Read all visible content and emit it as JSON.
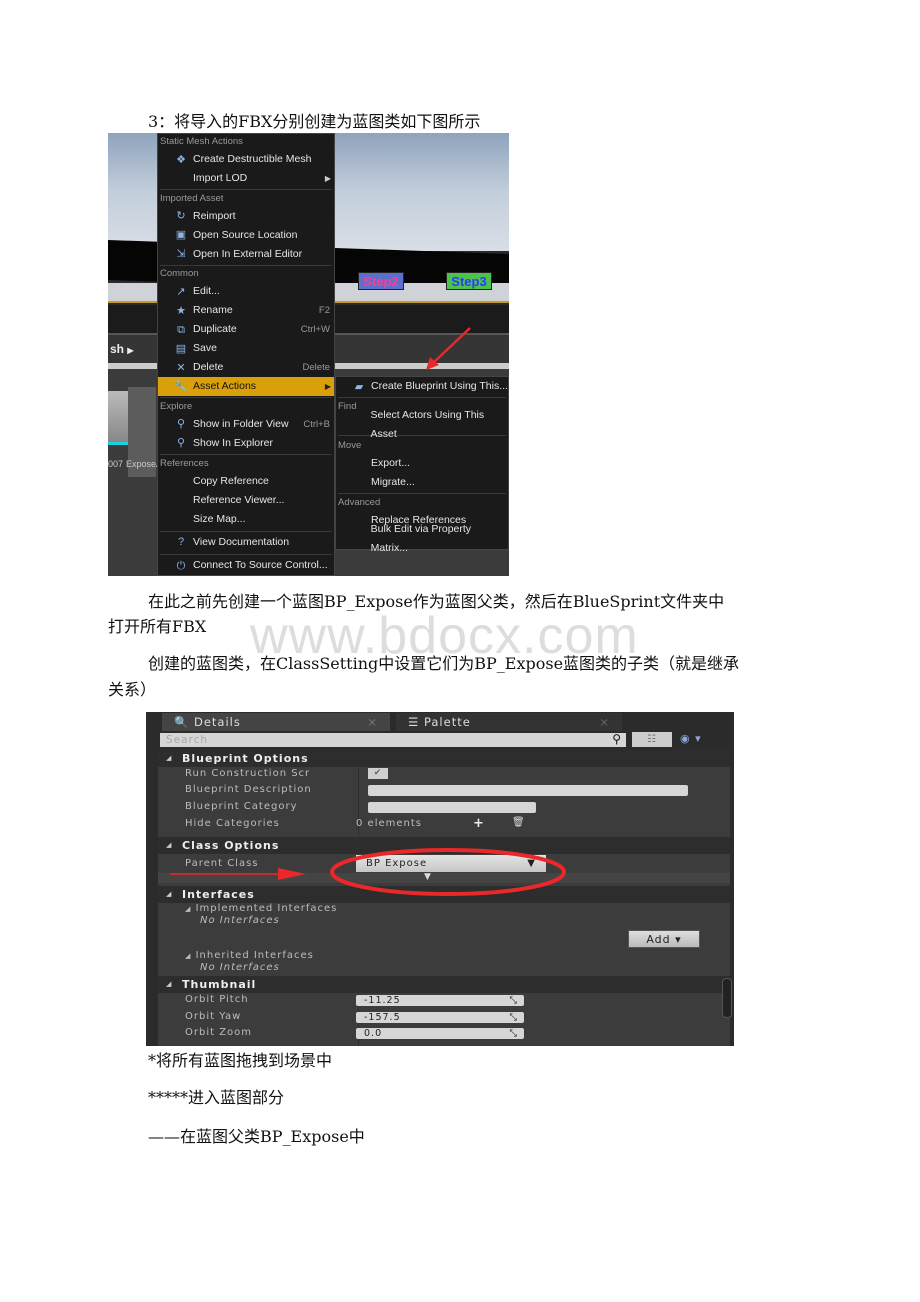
{
  "doc": {
    "heading": "3：将导入的FBX分别创建为蓝图类如下图所示",
    "para1_line1": "在此之前先创建一个蓝图BP_Expose作为蓝图父类，然后在BlueSprint文件夹中",
    "para1_line2": "打开所有FBX",
    "para2_line1": "创建的蓝图类，在ClassSetting中设置它们为BP_Expose蓝图类的子类（就是继承",
    "para2_line2": "关系）",
    "line3": "*将所有蓝图拖拽到场景中",
    "line4": "*****进入蓝图部分",
    "line5": "——在蓝图父类BP_Expose中",
    "watermark": "www.bdocx.com"
  },
  "shot1": {
    "breadcrumb": "sh",
    "steps": [
      {
        "label": "Step2",
        "bg": "#5a6fcf",
        "fg": "#ff3d8a"
      },
      {
        "label": "Step3",
        "bg": "#4cc24c",
        "fg": "#2b3cff"
      }
    ],
    "thumb_labels": [
      "007",
      "ExposeA"
    ],
    "menu": {
      "sections": [
        {
          "header": "Static Mesh Actions",
          "items": [
            {
              "label": "Create Destructible Mesh",
              "icon": "destructible-icon"
            },
            {
              "label": "Import LOD",
              "submenu": true
            }
          ]
        },
        {
          "header": "Imported Asset",
          "items": [
            {
              "label": "Reimport",
              "icon": "reimport-icon"
            },
            {
              "label": "Open Source Location",
              "icon": "folder-icon"
            },
            {
              "label": "Open In External Editor",
              "icon": "external-editor-icon"
            }
          ]
        },
        {
          "header": "Common",
          "items": [
            {
              "label": "Edit...",
              "icon": "edit-icon"
            },
            {
              "label": "Rename",
              "icon": "rename-icon",
              "shortcut": "F2"
            },
            {
              "label": "Duplicate",
              "icon": "duplicate-icon",
              "shortcut": "Ctrl+W"
            },
            {
              "label": "Save",
              "icon": "save-icon"
            },
            {
              "label": "Delete",
              "icon": "delete-icon",
              "shortcut": "Delete"
            },
            {
              "label": "Asset Actions",
              "icon": "wrench-icon",
              "submenu": true,
              "highlighted": true
            }
          ]
        },
        {
          "header": "Explore",
          "items": [
            {
              "label": "Show in Folder View",
              "icon": "magnifier-icon",
              "shortcut": "Ctrl+B"
            },
            {
              "label": "Show In Explorer",
              "icon": "magnifier-icon"
            }
          ]
        },
        {
          "header": "References",
          "items": [
            {
              "label": "Copy Reference"
            },
            {
              "label": "Reference Viewer..."
            },
            {
              "label": "Size Map..."
            }
          ]
        },
        {
          "header": "",
          "items": [
            {
              "label": "View Documentation",
              "icon": "help-icon"
            }
          ]
        },
        {
          "header": "",
          "items": [
            {
              "label": "Connect To Source Control...",
              "icon": "source-control-icon"
            }
          ]
        }
      ]
    },
    "submenu": {
      "sections": [
        {
          "header": "",
          "items": [
            {
              "label": "Create Blueprint Using This...",
              "icon": "blueprint-icon"
            }
          ]
        },
        {
          "header": "Find",
          "items": [
            {
              "label": "Select Actors Using This Asset"
            }
          ]
        },
        {
          "header": "Move",
          "items": [
            {
              "label": "Export..."
            },
            {
              "label": "Migrate..."
            }
          ]
        },
        {
          "header": "Advanced",
          "items": [
            {
              "label": "Replace References"
            },
            {
              "label": "Bulk Edit via Property Matrix..."
            }
          ]
        }
      ]
    },
    "highlight_color": "#d9a00a"
  },
  "shot2": {
    "tabs": [
      {
        "label": "Details",
        "icon": "details-icon"
      },
      {
        "label": "Palette",
        "icon": "palette-icon"
      }
    ],
    "search_placeholder": "Search",
    "sections": {
      "blueprint_options": {
        "title": "Blueprint Options",
        "run_construction": "Run Construction Scr",
        "run_construction_checked": true,
        "description": "Blueprint Description",
        "category": "Blueprint Category",
        "hide_categories": "Hide Categories",
        "hide_value": "0 elements"
      },
      "class_options": {
        "title": "Class Options",
        "parent_class_label": "Parent Class",
        "parent_class_value": "BP Expose"
      },
      "interfaces": {
        "title": "Interfaces",
        "implemented": "Implemented Interfaces",
        "implemented_value": "No Interfaces",
        "add_button": "Add",
        "inherited": "Inherited Interfaces",
        "inherited_value": "No Interfaces"
      },
      "thumbnail": {
        "title": "Thumbnail",
        "orbit_pitch_label": "Orbit Pitch",
        "orbit_pitch": "-11.25",
        "orbit_yaw_label": "Orbit Yaw",
        "orbit_yaw": "-157.5",
        "orbit_zoom_label": "Orbit Zoom",
        "orbit_zoom": "0.0"
      }
    },
    "annotation_color": "#e8282a"
  }
}
